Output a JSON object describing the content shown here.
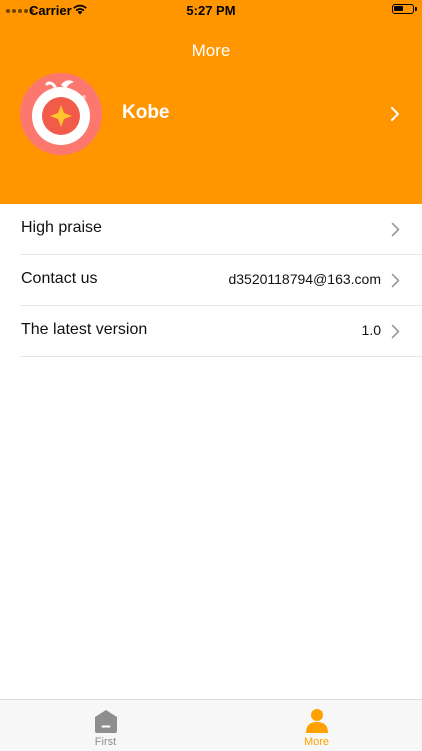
{
  "status_bar": {
    "carrier": "Carrier",
    "time": "5:27 PM"
  },
  "header": {
    "title": "More",
    "background_color": "#ff9600"
  },
  "profile": {
    "name": "Kobe",
    "avatar_icon": "orange-star-logo-icon"
  },
  "list": {
    "items": [
      {
        "label": "High praise",
        "value": ""
      },
      {
        "label": "Contact us",
        "value": "d3520118794@163.com"
      },
      {
        "label": "The latest version",
        "value": "1.0"
      }
    ]
  },
  "tabbar": {
    "tabs": [
      {
        "label": "First",
        "icon": "home-icon",
        "active": false
      },
      {
        "label": "More",
        "icon": "person-icon",
        "active": true
      }
    ],
    "active_color": "#ffa100",
    "inactive_color": "#8e8e8e"
  }
}
